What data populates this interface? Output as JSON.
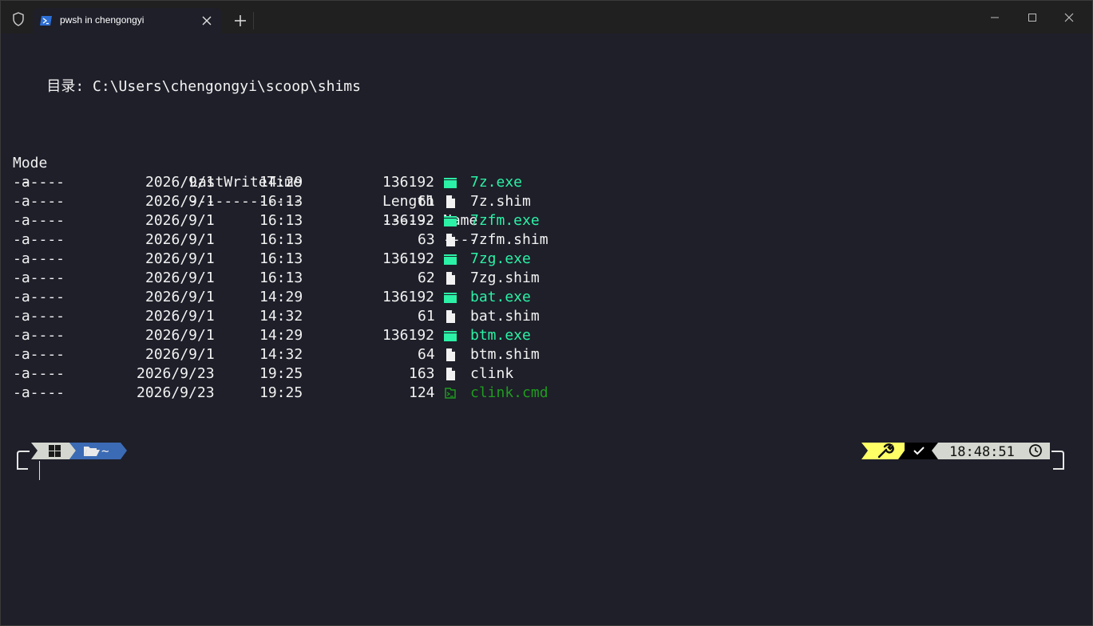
{
  "titlebar": {
    "tab_title": "pwsh in chengongyi",
    "icons": [
      "shield-icon",
      "powershell-icon",
      "close-icon",
      "plus-icon",
      "minimize-icon",
      "maximize-icon",
      "window-close-icon"
    ]
  },
  "terminal": {
    "directory_line": "    目录: C:\\Users\\chengongyi\\scoop\\shims",
    "headers": {
      "mode": "Mode",
      "lastwritetime": "LastWriteTime",
      "length": "Length",
      "name": "Name"
    },
    "header_underline": {
      "mode": "----",
      "lastwritetime": "-------------",
      "length": "------",
      "name": "----"
    },
    "rows": [
      {
        "mode": "-a----",
        "date": "2026/9/1",
        "time": "14:29",
        "length": "136192",
        "name": "7z.exe",
        "kind": "exe"
      },
      {
        "mode": "-a----",
        "date": "2026/9/1",
        "time": "16:13",
        "length": "61",
        "name": "7z.shim",
        "kind": "file"
      },
      {
        "mode": "-a----",
        "date": "2026/9/1",
        "time": "16:13",
        "length": "136192",
        "name": "7zfm.exe",
        "kind": "exe"
      },
      {
        "mode": "-a----",
        "date": "2026/9/1",
        "time": "16:13",
        "length": "63",
        "name": "7zfm.shim",
        "kind": "file"
      },
      {
        "mode": "-a----",
        "date": "2026/9/1",
        "time": "16:13",
        "length": "136192",
        "name": "7zg.exe",
        "kind": "exe"
      },
      {
        "mode": "-a----",
        "date": "2026/9/1",
        "time": "16:13",
        "length": "62",
        "name": "7zg.shim",
        "kind": "file"
      },
      {
        "mode": "-a----",
        "date": "2026/9/1",
        "time": "14:29",
        "length": "136192",
        "name": "bat.exe",
        "kind": "exe"
      },
      {
        "mode": "-a----",
        "date": "2026/9/1",
        "time": "14:32",
        "length": "61",
        "name": "bat.shim",
        "kind": "file"
      },
      {
        "mode": "-a----",
        "date": "2026/9/1",
        "time": "14:29",
        "length": "136192",
        "name": "btm.exe",
        "kind": "exe"
      },
      {
        "mode": "-a----",
        "date": "2026/9/1",
        "time": "14:32",
        "length": "64",
        "name": "btm.shim",
        "kind": "file"
      },
      {
        "mode": "-a----",
        "date": "2026/9/23",
        "time": "19:25",
        "length": "163",
        "name": "clink",
        "kind": "file"
      },
      {
        "mode": "-a----",
        "date": "2026/9/23",
        "time": "19:25",
        "length": "124",
        "name": "clink.cmd",
        "kind": "cmd"
      }
    ]
  },
  "prompt": {
    "left_segments": [
      {
        "icon": "windows-icon",
        "text": ""
      },
      {
        "icon": "folder-open-icon",
        "text": "~"
      }
    ],
    "right_segments": {
      "tool_icon": "wrench-icon",
      "status_icon": "check-icon",
      "time": "18:48:51",
      "clock_icon": "clock-icon"
    },
    "colors": {
      "windows_segment": "#d3d7cf",
      "path_segment": "#3b6bb5",
      "tool_segment": "#ffff66",
      "status_segment": "#000000",
      "time_segment": "#d3d7cf"
    }
  },
  "colors": {
    "background": "#1e1f29",
    "foreground": "#f2f2f2",
    "exe": "#2bf2a6",
    "cmd": "#1f9c1f",
    "titlebar": "#202020"
  }
}
